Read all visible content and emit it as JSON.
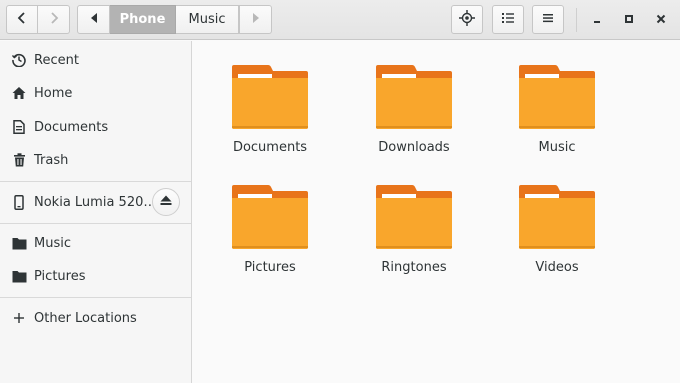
{
  "header": {
    "back_icon": "chevron-left-icon",
    "forward_icon": "chevron-right-icon",
    "path_left_icon": "triangle-left-icon",
    "path_right_icon": "triangle-right-icon",
    "path": [
      {
        "label": "Phone",
        "active": true
      },
      {
        "label": "Music",
        "active": false
      }
    ],
    "location_icon": "location-target-icon",
    "list_view_icon": "list-view-icon",
    "menu_icon": "hamburger-menu-icon",
    "minimize_icon": "minimize-icon",
    "maximize_icon": "maximize-icon",
    "close_icon": "close-icon"
  },
  "sidebar": {
    "items": [
      {
        "label": "Recent",
        "icon": "clock-icon"
      },
      {
        "label": "Home",
        "icon": "home-icon"
      },
      {
        "label": "Documents",
        "icon": "document-icon"
      },
      {
        "label": "Trash",
        "icon": "trash-icon"
      },
      {
        "label": "Nokia Lumia 520…",
        "icon": "phone-icon",
        "eject_icon": "eject-icon"
      },
      {
        "label": "Music",
        "icon": "folder-icon"
      },
      {
        "label": "Pictures",
        "icon": "folder-icon"
      },
      {
        "label": "Other Locations",
        "icon": "plus-icon"
      }
    ]
  },
  "folders": [
    {
      "label": "Documents"
    },
    {
      "label": "Downloads"
    },
    {
      "label": "Music"
    },
    {
      "label": "Pictures"
    },
    {
      "label": "Ringtones"
    },
    {
      "label": "Videos"
    }
  ],
  "colors": {
    "folder_body": "#f9a62c",
    "folder_tab": "#e8741a",
    "active_path": "#b3b3b3"
  }
}
